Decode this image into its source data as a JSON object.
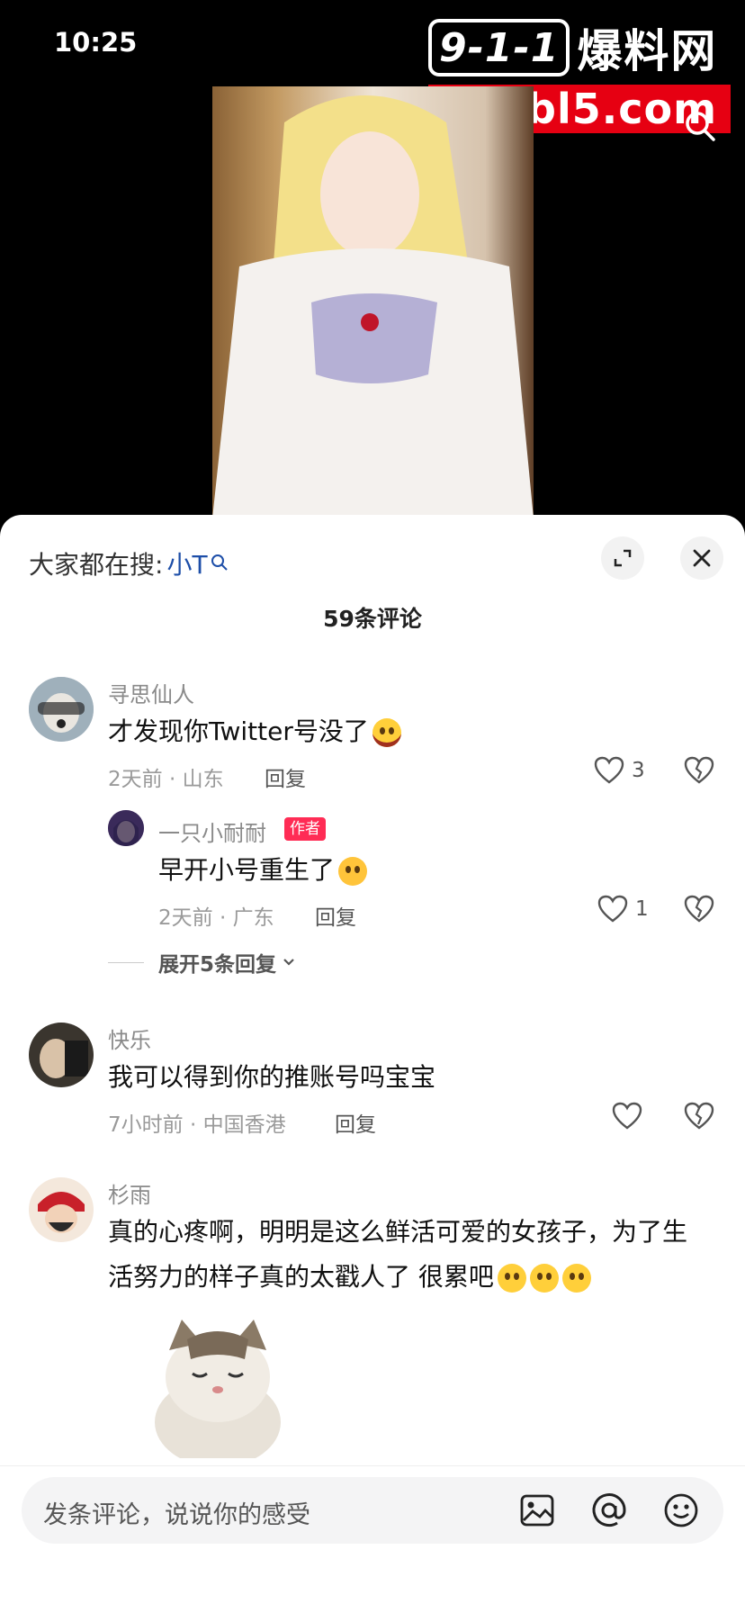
{
  "status": {
    "time": "10:25"
  },
  "watermark": {
    "badge": "9-1-1",
    "word": "爆料网",
    "domain": "911bl5.com"
  },
  "sheet": {
    "search_prefix": "大家都在搜:",
    "search_keyword": "小T",
    "comment_count": "59条评论"
  },
  "comments": [
    {
      "user": "寻思仙人",
      "text": "才发现你Twitter号没了",
      "emoji": "laughing-emoji",
      "meta": "2天前 · 山东",
      "reply_label": "回复",
      "likes": "3",
      "replies": [
        {
          "user": "一只小耐耐",
          "badge": "作者",
          "text": "早开小号重生了",
          "emoji": "smiling-emoji",
          "meta": "2天前 · 广东",
          "reply_label": "回复",
          "likes": "1"
        }
      ],
      "expand_label": "展开5条回复"
    },
    {
      "user": "快乐",
      "text": "我可以得到你的推账号吗宝宝",
      "meta": "7小时前 · 中国香港",
      "reply_label": "回复",
      "likes": ""
    },
    {
      "user": "杉雨",
      "text_line1": "真的心疼啊，明明是这么鲜活可爱的女孩子，为了生",
      "text_line2": "活努力的样子真的太戳人了 很累吧",
      "emoji": "pleading-emoji"
    }
  ],
  "input": {
    "placeholder": "发条评论，说说你的感受"
  },
  "icons": {
    "search": "search-icon",
    "fullscreen": "expand-icon",
    "close": "close-icon",
    "like": "heart-icon",
    "dislike": "broken-heart-icon",
    "image": "image-icon",
    "mention": "at-icon",
    "emoji": "emoji-icon"
  },
  "colors": {
    "keyword": "#1d4ea8",
    "author_badge": "#ff2c55",
    "watermark_red": "#e60012"
  }
}
